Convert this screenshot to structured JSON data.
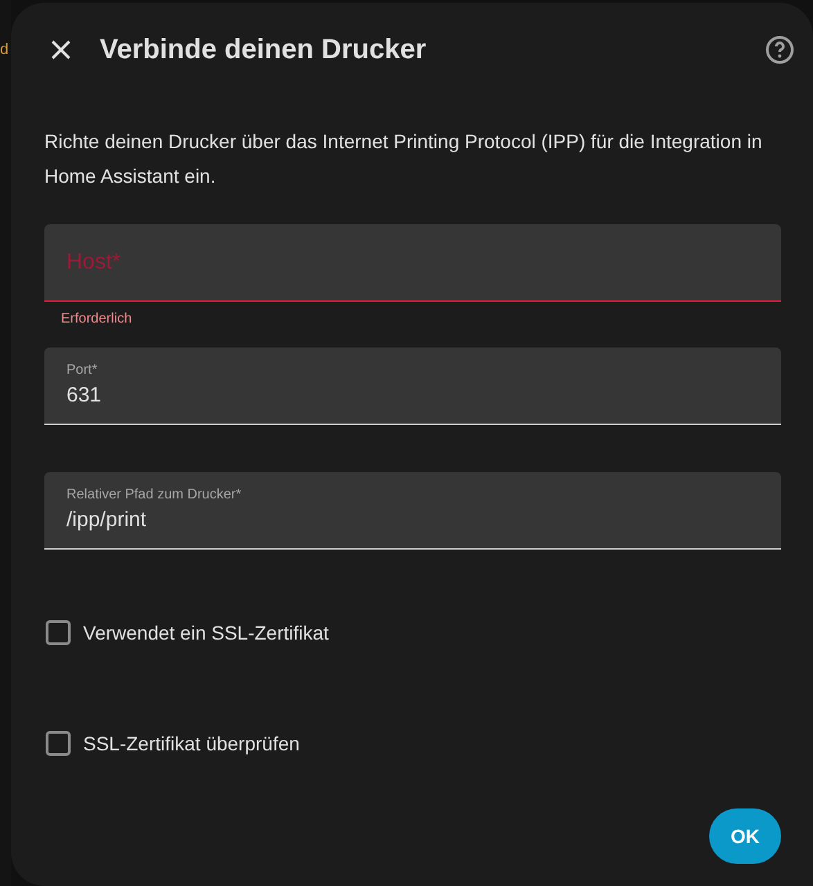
{
  "background": {
    "text_fragment": "d"
  },
  "dialog": {
    "title": "Verbinde deinen Drucker",
    "description": "Richte deinen Drucker über das Internet Printing Protocol (IPP) für die Integration in Home Assistant ein.",
    "fields": [
      {
        "label": "Host*",
        "invalid": true,
        "error": "Erforderlich"
      },
      {
        "label": "Port*",
        "value": "631",
        "invalid": false
      },
      {
        "label": "Relativer Pfad zum Drucker*",
        "value": "/ipp/print",
        "invalid": false
      }
    ],
    "checkboxes": [
      {
        "label": "Verwendet ein SSL-Zertifikat",
        "checked": false
      },
      {
        "label": "SSL-Zertifikat überprüfen",
        "checked": false
      }
    ],
    "button": "OK"
  }
}
